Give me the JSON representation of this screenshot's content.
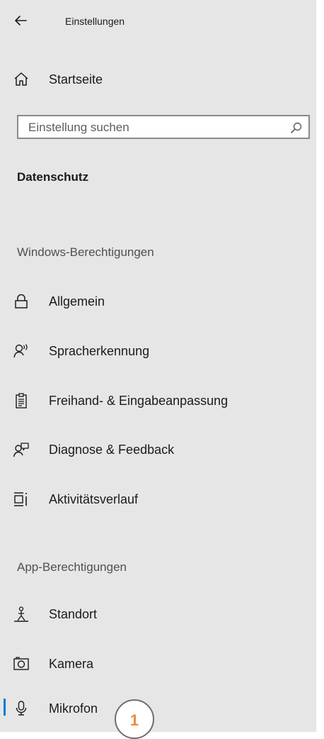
{
  "window": {
    "title": "Einstellungen"
  },
  "nav": {
    "home_label": "Startseite",
    "search": {
      "placeholder": "Einstellung suchen",
      "value": ""
    },
    "page_heading": "Datenschutz",
    "sections": [
      {
        "title": "Windows-Berechtigungen",
        "items": [
          {
            "label": "Allgemein",
            "icon": "lock-icon"
          },
          {
            "label": "Spracherkennung",
            "icon": "speech-icon"
          },
          {
            "label": "Freihand- & Eingabeanpassung",
            "icon": "clipboard-icon"
          },
          {
            "label": "Diagnose & Feedback",
            "icon": "feedback-icon"
          },
          {
            "label": "Aktivitätsverlauf",
            "icon": "timeline-icon"
          }
        ]
      },
      {
        "title": "App-Berechtigungen",
        "items": [
          {
            "label": "Standort",
            "icon": "location-icon"
          },
          {
            "label": "Kamera",
            "icon": "camera-icon"
          },
          {
            "label": "Mikrofon",
            "icon": "microphone-icon",
            "selected": true
          }
        ]
      }
    ]
  },
  "annotation": {
    "step_number": "1"
  },
  "colors": {
    "accent": "#0078d7",
    "badge_text": "#f08a3c",
    "panel_bg": "#e6e6e6"
  }
}
